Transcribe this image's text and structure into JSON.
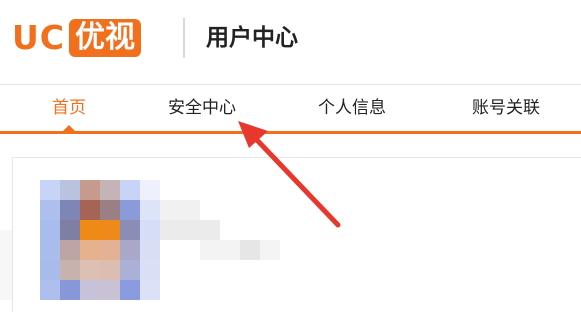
{
  "header": {
    "logo_uc": "UC",
    "logo_youshi": "优视",
    "title": "用户中心"
  },
  "nav": {
    "tabs": [
      {
        "label": "首页",
        "active": true
      },
      {
        "label": "安全中心",
        "active": false
      },
      {
        "label": "个人信息",
        "active": false
      },
      {
        "label": "账号关联",
        "active": false
      }
    ]
  },
  "colors": {
    "accent": "#f0701e",
    "annotation_arrow": "#e8372c"
  }
}
